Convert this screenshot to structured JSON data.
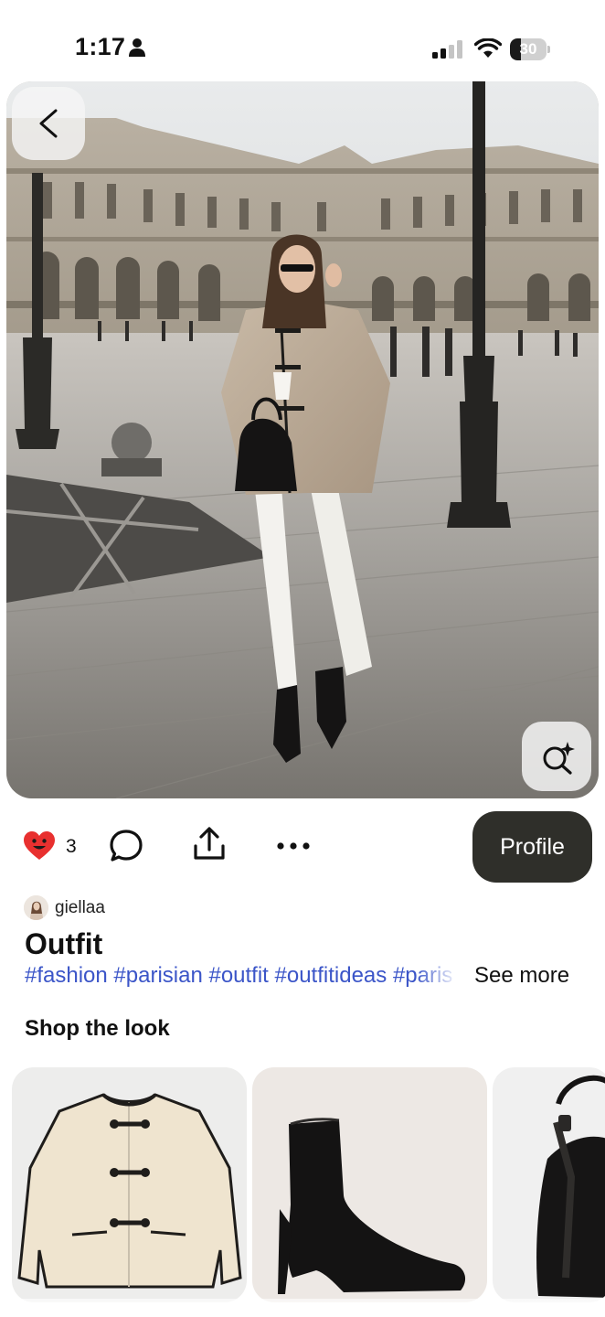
{
  "status_bar": {
    "time": "1:17",
    "battery_percent": "30",
    "battery_level": 0.3
  },
  "pin": {
    "image_description_icons": {
      "back": "chevron-left-icon",
      "visual_search": "lens-sparkle-icon"
    },
    "reaction_count": "3",
    "profile_button_label": "Profile",
    "author_name": "giellaa",
    "title": "Outfit",
    "hashtags": "#fashion #parisian #outfit #outfitideas #paris #style",
    "see_more_label": "See more"
  },
  "shop_the_look": {
    "heading": "Shop the look",
    "items": [
      {
        "icon": "jacket-product-image"
      },
      {
        "icon": "boot-product-image"
      },
      {
        "icon": "bag-product-image"
      }
    ]
  },
  "colors": {
    "profile_button_bg": "#2f2f2a",
    "hashtag_blue": "#3b55c8",
    "heart_red": "#e8302f"
  }
}
